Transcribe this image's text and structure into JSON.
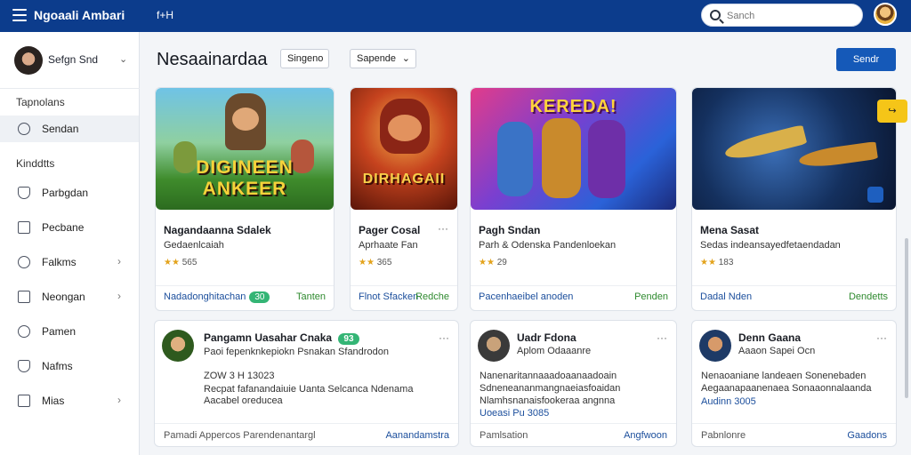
{
  "topbar": {
    "brand_primary": "Ngoaali",
    "brand_secondary": "Ambari",
    "link": "f+H",
    "search_placeholder": "Sanch"
  },
  "sidebar": {
    "user_name": "Sefgn Snd",
    "section_1": "Tapnolans",
    "section_2": "Kinddtts",
    "items": [
      {
        "label": "Sendan",
        "icon": "search-icon"
      },
      {
        "label": "Parbgdan",
        "icon": "shield-icon"
      },
      {
        "label": "Pecbane",
        "icon": "document-icon"
      },
      {
        "label": "Falkms",
        "icon": "clock-icon"
      },
      {
        "label": "Neongan",
        "icon": "list-icon"
      },
      {
        "label": "Pamen",
        "icon": "circle-icon"
      },
      {
        "label": "Nafms",
        "icon": "location-icon"
      },
      {
        "label": "Mias",
        "icon": "card-icon"
      }
    ]
  },
  "main": {
    "title": "Nesaainardaa",
    "filter_1": "Singeno",
    "filter_2": "Sapende",
    "action_button": "Sendr"
  },
  "games": [
    {
      "art": "DIGINEEN ANKEER",
      "title": "Nagandaanna Sdalek",
      "subtitle": "Gedaenlcaiah",
      "stars": "★★",
      "rating": "565",
      "footer_left": "Nadadonghitachan",
      "footer_badge": "30",
      "footer_right": "Tanten"
    },
    {
      "art": "DIRHAGAII",
      "title": "Pager Cosal",
      "subtitle": "Aprhaate Fan",
      "stars": "★★",
      "rating": "365",
      "footer_left": "Flnot Sfacken",
      "footer_right": "Redche"
    },
    {
      "art": "KEREDA!",
      "title": "Pagh Sndan",
      "subtitle": "Parh & Odenska Pandenloekan",
      "stars": "★★",
      "rating": "29",
      "footer_left": "Pacenhaeibel anoden",
      "footer_right": "Penden"
    },
    {
      "art": "",
      "title": "Mena Sasat",
      "subtitle": "Sedas indeansayedfetaendadan",
      "stars": "★★",
      "rating": "183",
      "footer_left": "Dadal Nden",
      "footer_right": "Dendetts"
    }
  ],
  "posts": [
    {
      "name": "Pangamn Uasahar Cnaka",
      "badge": "93",
      "line1": "Paoi fepenknkepiokn Psnakan Sfandrodon",
      "line2": "ZOW 3 H 13023",
      "line3": "Recpat fafanandaiuie Uanta Selcanca Ndenama",
      "line4": "Aacabel oreducea",
      "footer_left": "Pamadi Appercos Parendenantargl",
      "footer_right": "Aanandamstra"
    },
    {
      "name": "Uadr Fdona",
      "line1": "Aplom Odaaanre",
      "line2": "Nanenaritannaaadoaanaadoain",
      "line3": "Sdneneananmangnaeiasfoaidan",
      "line4": "Nlamhsnanaisfookeraa angnna",
      "line5": "Uoeasi Pu 3085",
      "footer_left": "Pamlsation",
      "footer_right": "Angfwoon"
    },
    {
      "name": "Denn Gaana",
      "line1": "Aaaon Sapei Ocn",
      "line2": "Nenaoaniane landeaen Sonenebaden",
      "line3": "Aegaanapaanenaea Sonaaonnalaanda",
      "line4": "Audinn 3005",
      "footer_left": "Pabnlonre",
      "footer_right": "Gaadons"
    }
  ]
}
